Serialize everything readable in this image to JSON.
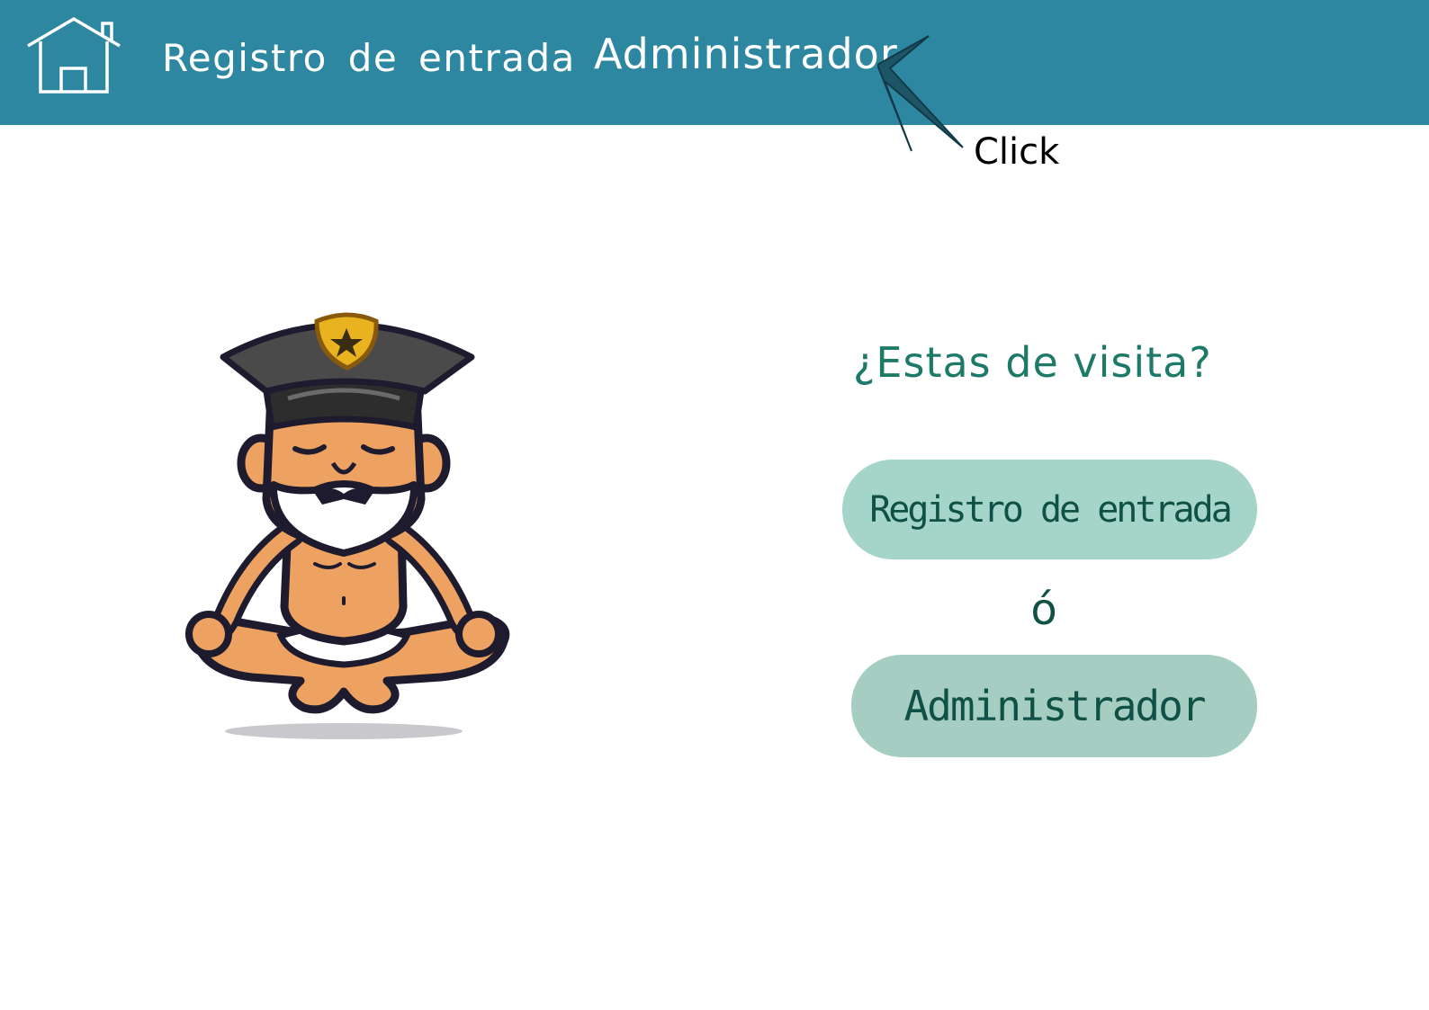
{
  "header": {
    "home_icon": "house-icon",
    "nav_registro": "Registro de entrada",
    "nav_admin": "Administrador",
    "click_hint": "Click",
    "arrow_icon": "arrow-pointer-icon",
    "background_color": "#2e87a0"
  },
  "main": {
    "illustration": "meditating-police-officer-illustration",
    "question": "¿Estas de visita?",
    "registro_button": "Registro de entrada",
    "or_text": "ó",
    "admin_button": "Administrador",
    "accent_color": "#1e7a68",
    "button_color": "#a5d4c8"
  }
}
